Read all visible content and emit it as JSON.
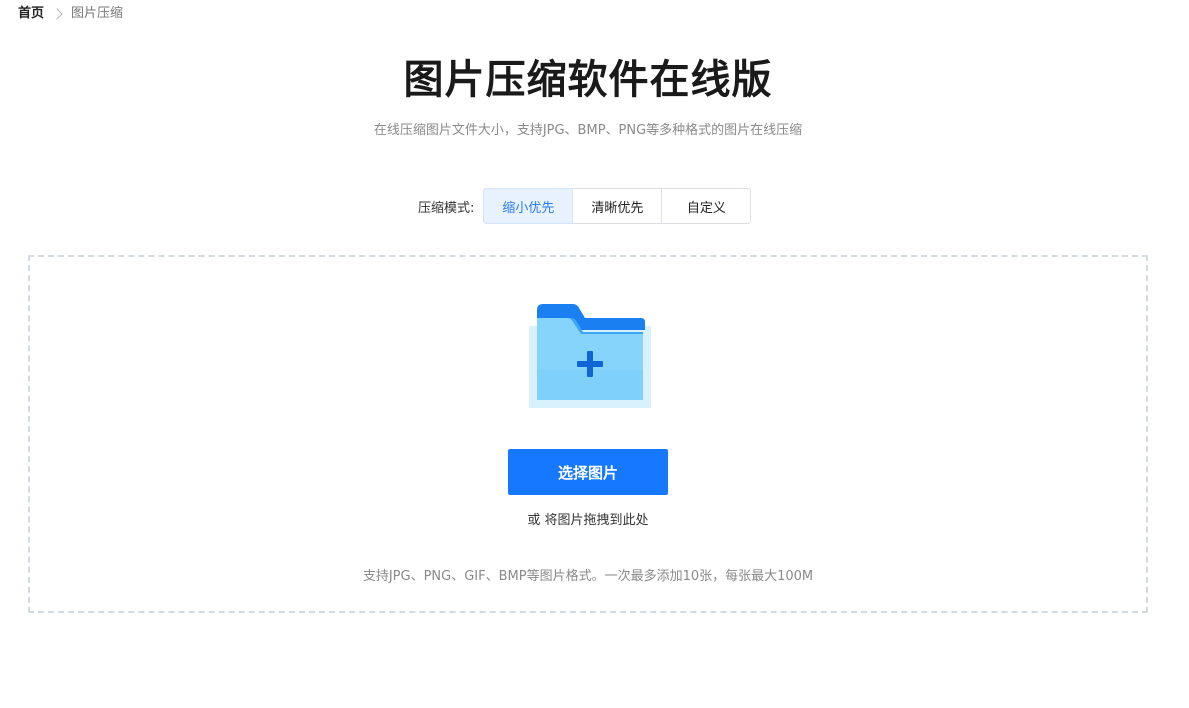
{
  "breadcrumb": {
    "home": "首页",
    "current": "图片压缩"
  },
  "header": {
    "title": "图片压缩软件在线版",
    "subtitle": "在线压缩图片文件大小，支持JPG、BMP、PNG等多种格式的图片在线压缩"
  },
  "compression_mode": {
    "label": "压缩模式:",
    "options": [
      {
        "label": "缩小优先",
        "selected": true
      },
      {
        "label": "清晰优先",
        "selected": false
      },
      {
        "label": "自定义",
        "selected": false
      }
    ]
  },
  "upload": {
    "icon": "folder-plus-icon",
    "button_label": "选择图片",
    "drop_hint": "或 将图片拖拽到此处",
    "format_note": "支持JPG、PNG、GIF、BMP等图片格式。一次最多添加10张，每张最大100M"
  },
  "colors": {
    "primary": "#1677ff",
    "active_tab_bg": "#e8f2fe",
    "active_tab_text": "#2a7cf0",
    "folder_light": "#7fd3fb",
    "folder_dark": "#0f6fe8"
  }
}
